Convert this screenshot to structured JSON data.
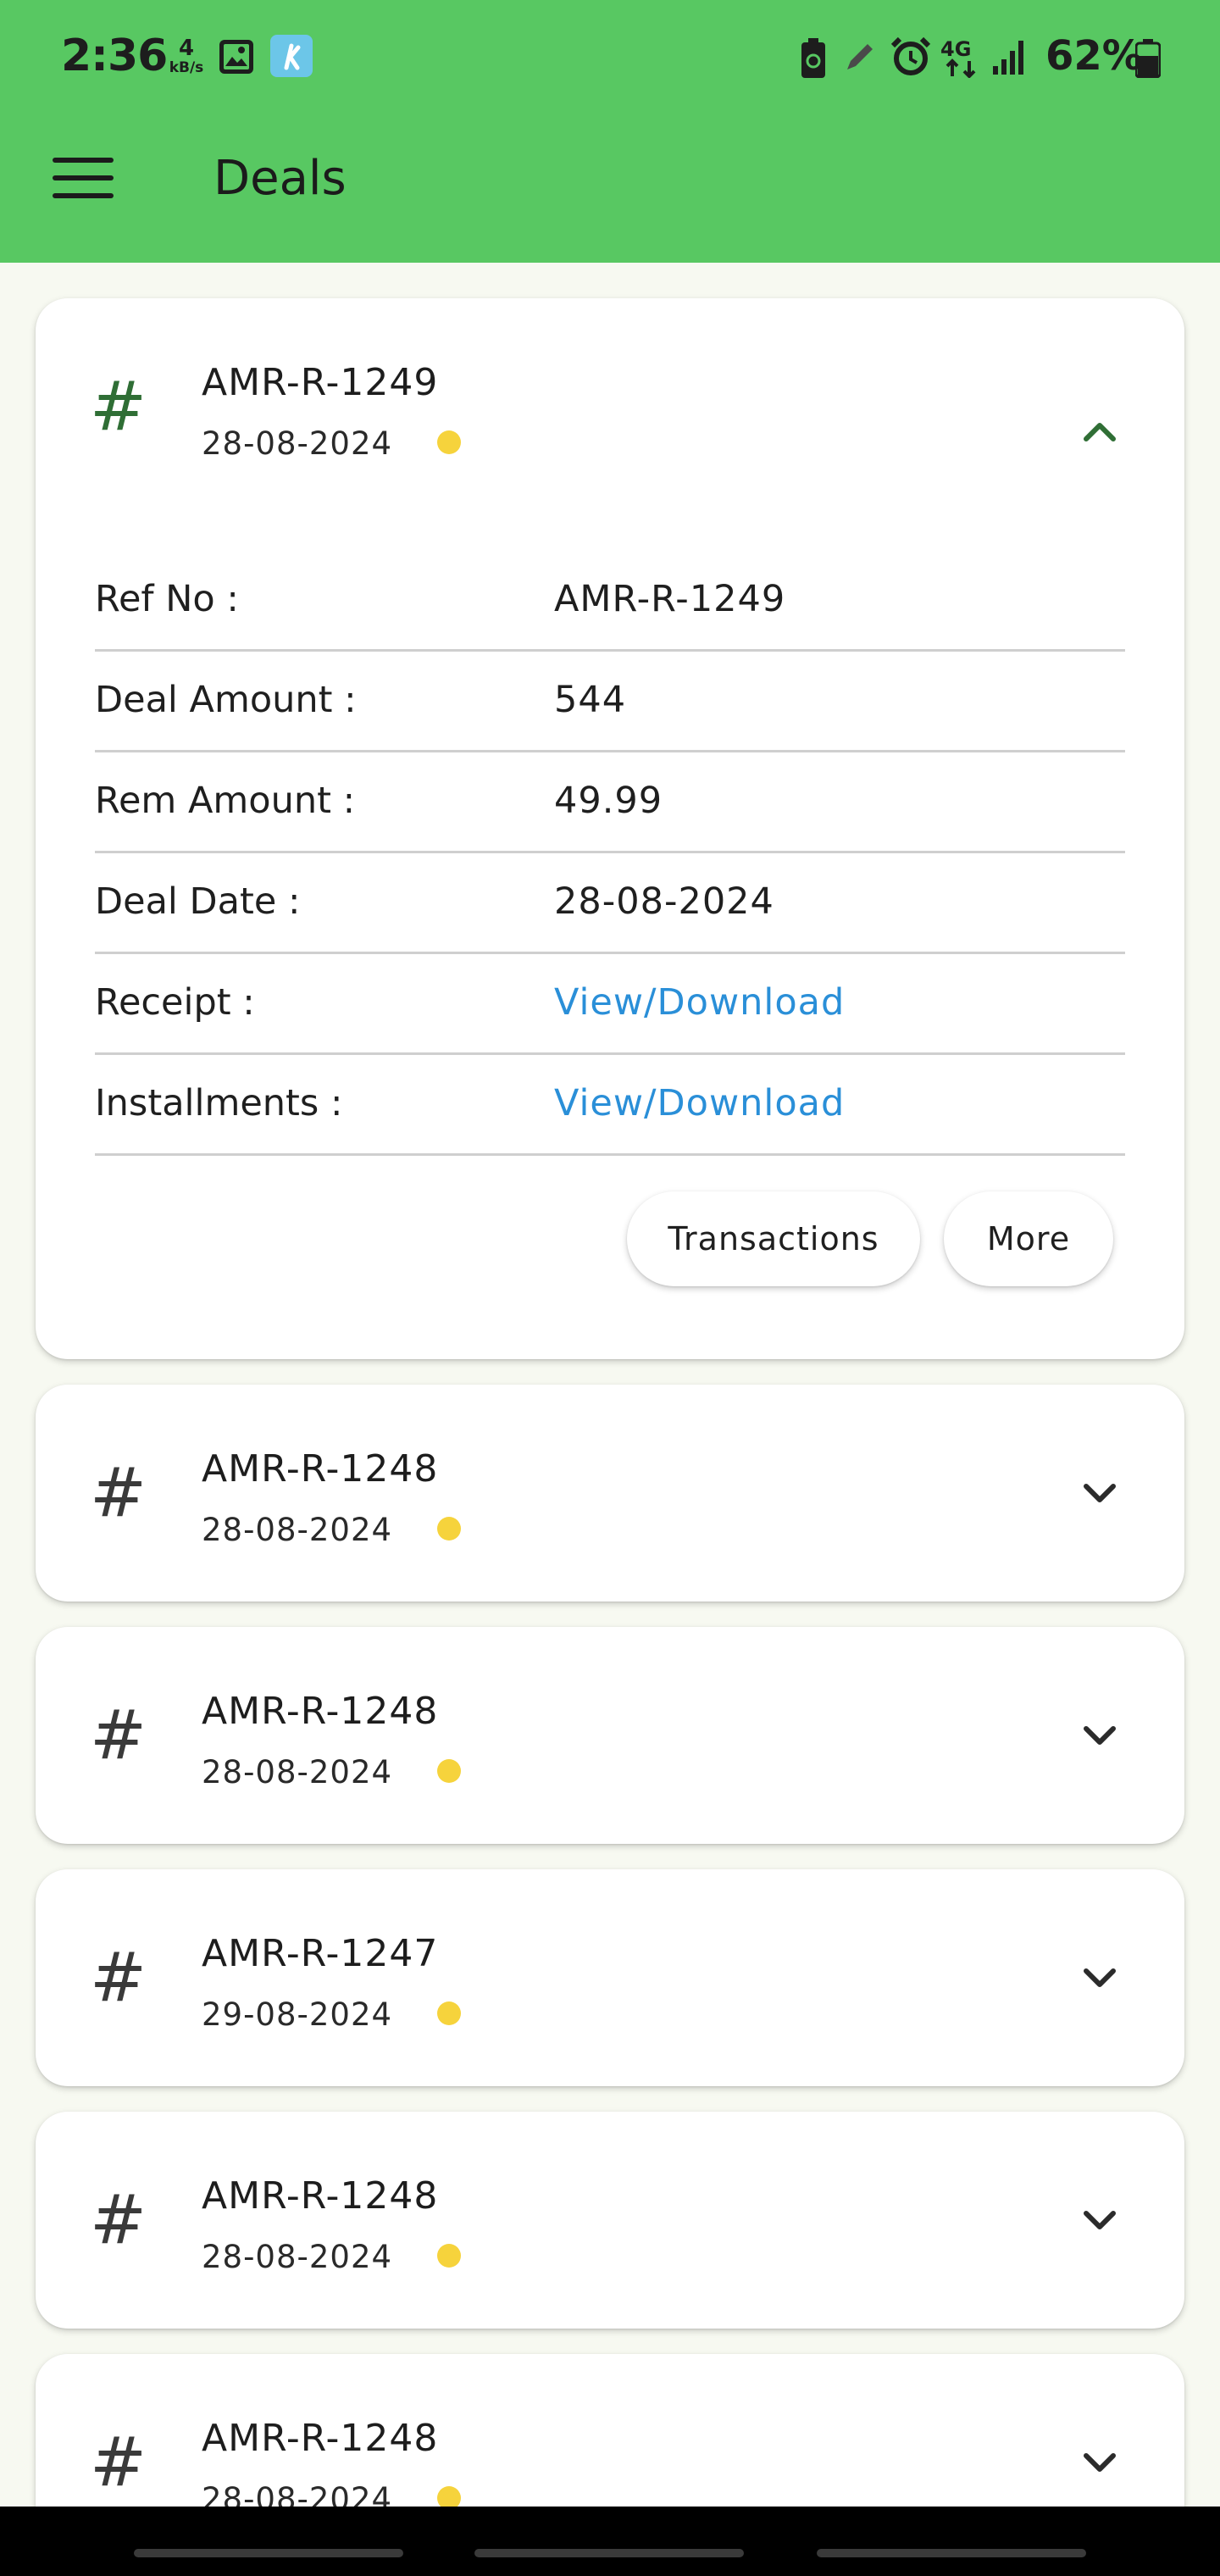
{
  "status_bar": {
    "time": "2:36",
    "net_speed": "4",
    "net_speed_unit": "kB/s",
    "battery": "62%",
    "icons": [
      "gallery-icon",
      "kite-app-icon",
      "battery-saver-icon",
      "pen-icon",
      "alarm-icon",
      "4g-data-icon",
      "signal-icon",
      "battery-icon"
    ]
  },
  "app_bar": {
    "title": "Deals",
    "menu_icon": "hamburger-menu-icon"
  },
  "colors": {
    "app_bar": "#58c862",
    "link": "#2a8fd8",
    "status_dot": "#f6d33c",
    "open_accent": "#2f6e35"
  },
  "expanded_deal": {
    "ref": "AMR-R-1249",
    "date": "28-08-2024",
    "details": [
      {
        "label": "Ref No :",
        "value": "AMR-R-1249",
        "is_link": false
      },
      {
        "label": "Deal Amount :",
        "value": "544",
        "is_link": false
      },
      {
        "label": "Rem Amount :",
        "value": "49.99",
        "is_link": false
      },
      {
        "label": "Deal Date :",
        "value": "28-08-2024",
        "is_link": false
      },
      {
        "label": "Receipt :",
        "value": "View/Download",
        "is_link": true
      },
      {
        "label": "Installments :",
        "value": "View/Download",
        "is_link": true
      }
    ],
    "buttons": {
      "transactions": "Transactions",
      "more": "More"
    }
  },
  "deals": [
    {
      "ref": "AMR-R-1248",
      "date": "28-08-2024"
    },
    {
      "ref": "AMR-R-1248",
      "date": "28-08-2024"
    },
    {
      "ref": "AMR-R-1247",
      "date": "29-08-2024"
    },
    {
      "ref": "AMR-R-1248",
      "date": "28-08-2024"
    },
    {
      "ref": "AMR-R-1248",
      "date": "28-08-2024"
    }
  ],
  "hash_symbol": "#"
}
